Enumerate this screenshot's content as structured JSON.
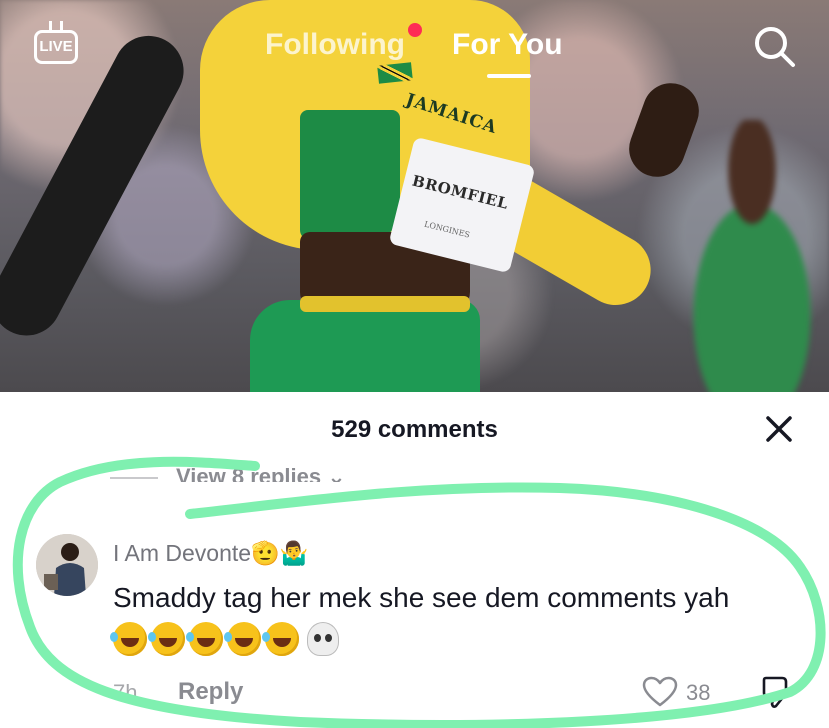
{
  "nav": {
    "live_label": "LIVE",
    "tab_following": "Following",
    "tab_foryou": "For You"
  },
  "video": {
    "jersey_text": "JAMAICA",
    "bib_name": "BROMFIEL",
    "bib_sponsor": "LONGINES"
  },
  "comments": {
    "title": "529 comments",
    "view_replies": "View 8 replies",
    "comment": {
      "username": "I Am Devonte",
      "username_emojis": "🫡🤷‍♂️",
      "text": "Smaddy tag her mek she see dem comments yah",
      "emoji_line": "🤣🤣🤣🤣🤣💀",
      "time": "7h",
      "reply_label": "Reply",
      "likes": "38"
    }
  },
  "colors": {
    "highlight": "#7ff0b0",
    "notif_dot": "#fe2c55",
    "text_primary": "#161823",
    "text_secondary": "#8a8b91"
  }
}
